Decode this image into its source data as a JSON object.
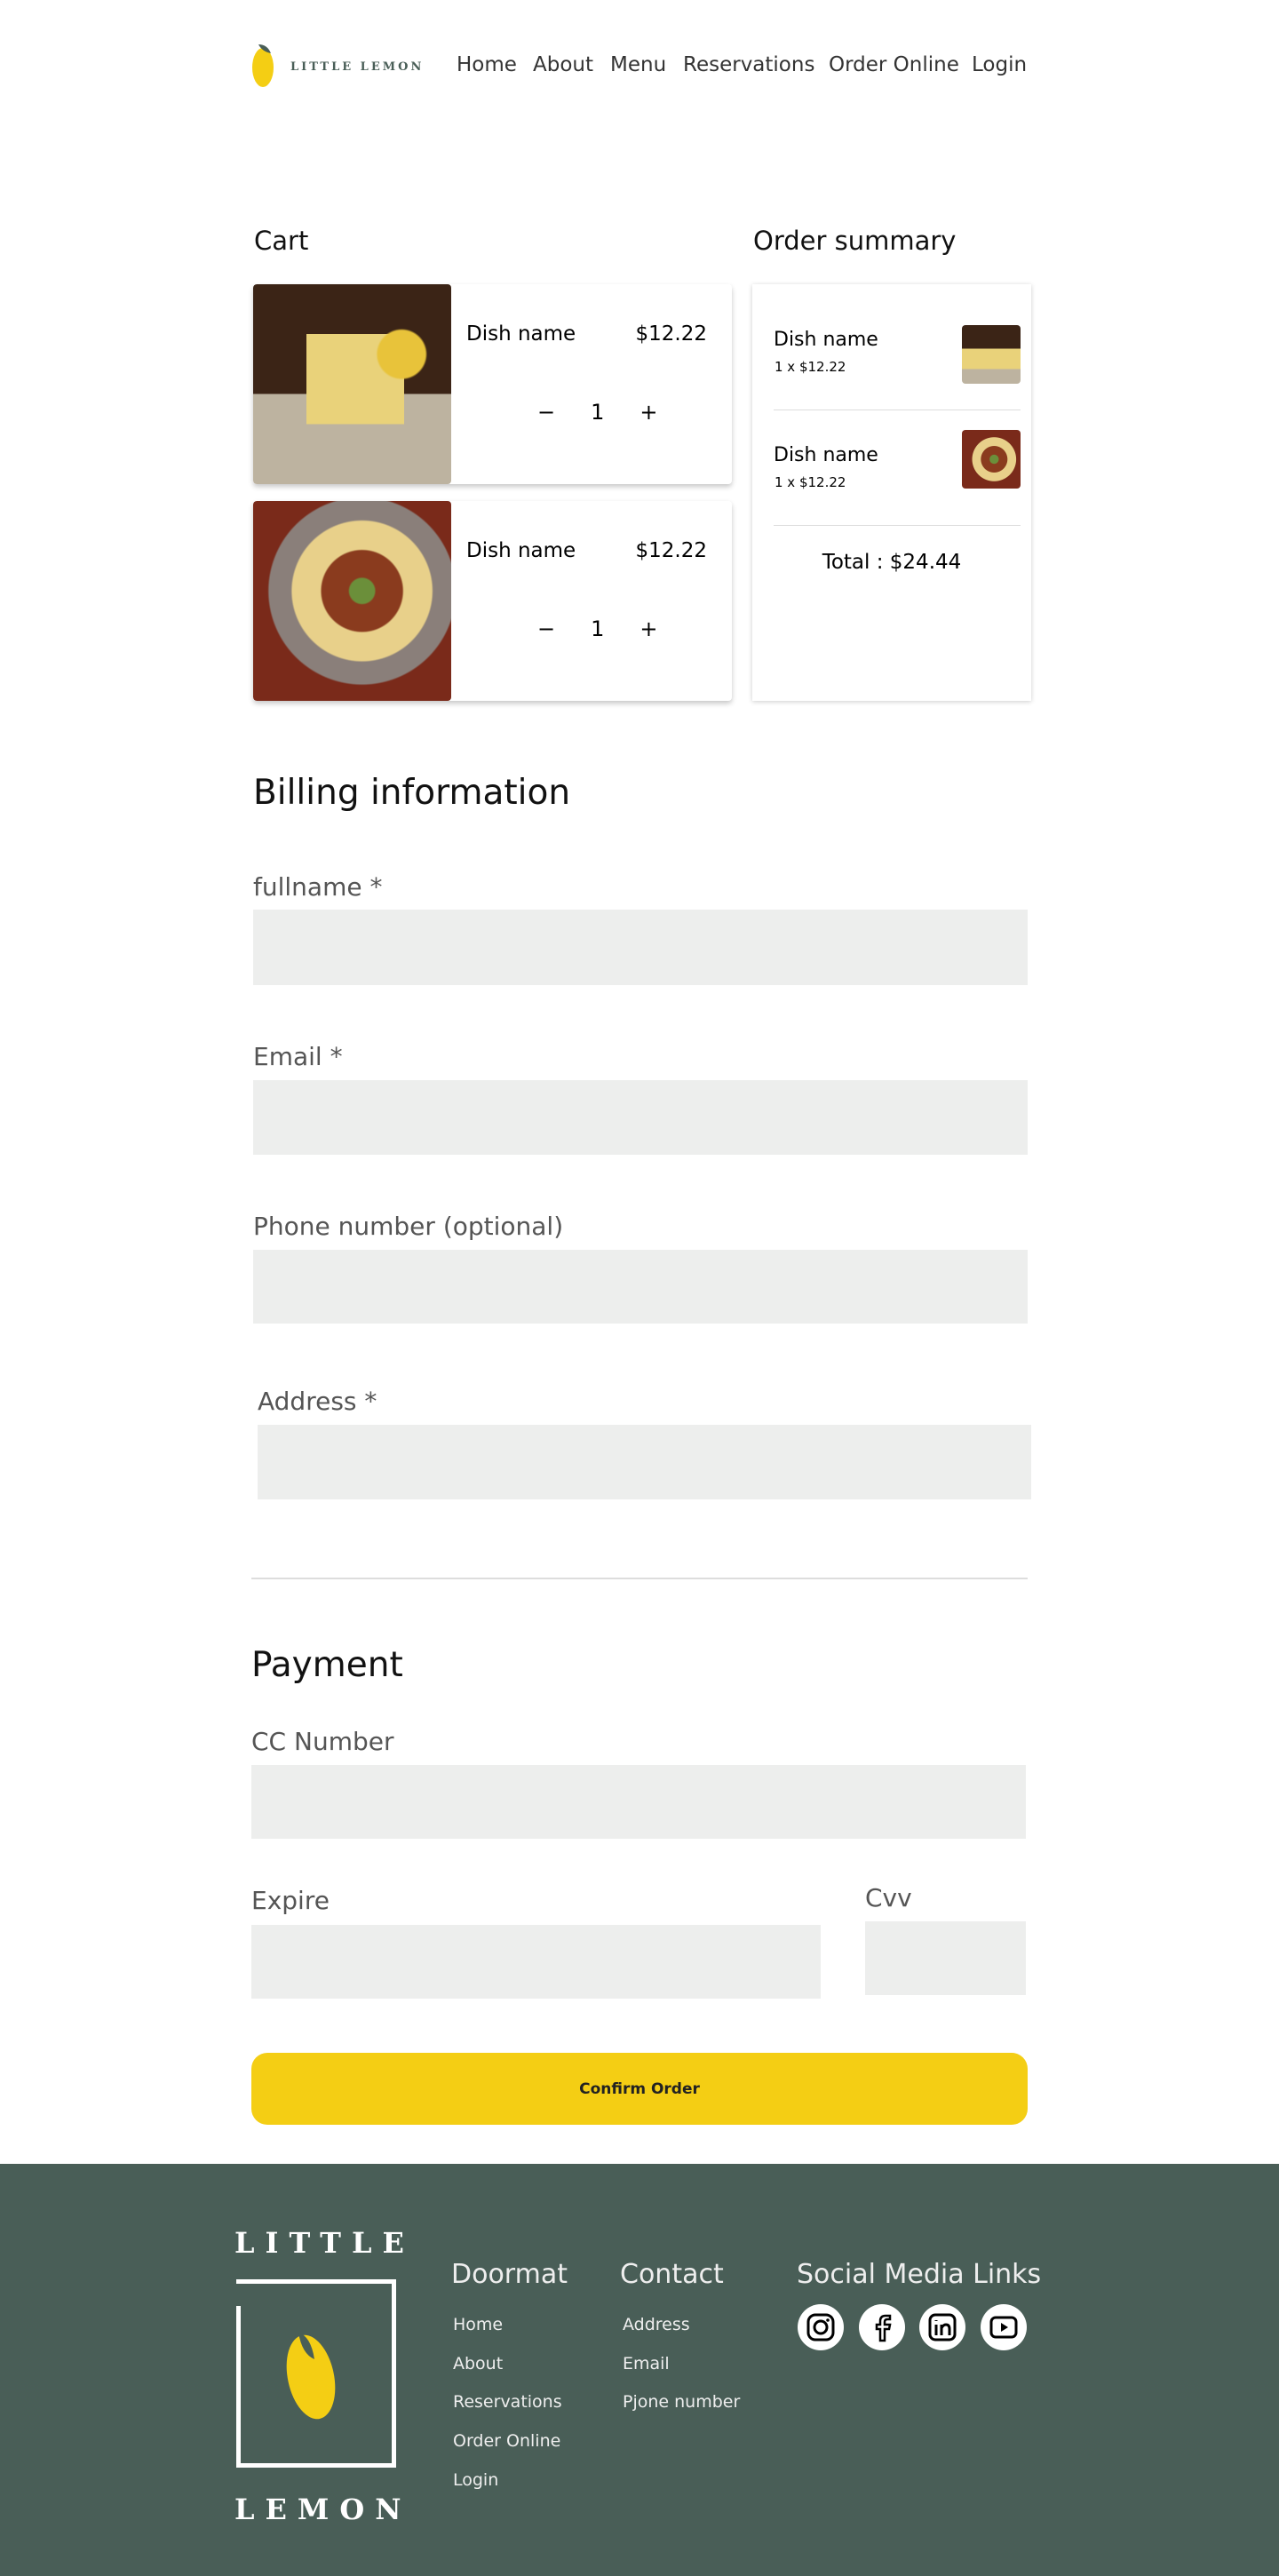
{
  "header": {
    "logo_text": "LITTLE LEMON",
    "nav": [
      "Home",
      "About",
      "Menu",
      "Reservations",
      "Order Online",
      "Login"
    ]
  },
  "cart": {
    "title": "Cart",
    "items": [
      {
        "name": "Dish name",
        "price": "$12.22",
        "qty": "1",
        "image": "lemon-cake"
      },
      {
        "name": "Dish name",
        "price": "$12.22",
        "qty": "1",
        "image": "spaghetti-bolognese"
      }
    ]
  },
  "summary": {
    "title": "Order summary",
    "items": [
      {
        "name": "Dish name",
        "line": "1 x $12.22"
      },
      {
        "name": "Dish name",
        "line": "1 x $12.22"
      }
    ],
    "total": "Total : $24.44"
  },
  "billing": {
    "title": "Billing information",
    "fullname": "fullname *",
    "email": "Email *",
    "phone": "Phone number (optional)",
    "address": "Address *"
  },
  "payment": {
    "title": "Payment",
    "cc": "CC Number",
    "expire": "Expire",
    "cvv": "Cvv",
    "confirm": "Confirm Order"
  },
  "footer": {
    "logo_top": "LITTLE",
    "logo_bottom": "LEMON",
    "doormat": {
      "title": "Doormat",
      "links": [
        "Home",
        "About",
        "Reservations",
        "Order Online",
        "Login"
      ]
    },
    "contact": {
      "title": "Contact",
      "links": [
        "Address",
        "Email",
        "Pjone number"
      ]
    },
    "social": {
      "title": "Social Media Links",
      "icons": [
        "instagram-icon",
        "facebook-icon",
        "linkedin-icon",
        "youtube-icon"
      ]
    }
  },
  "colors": {
    "primary_yellow": "#F4CE14",
    "footer_green": "#495E57"
  }
}
